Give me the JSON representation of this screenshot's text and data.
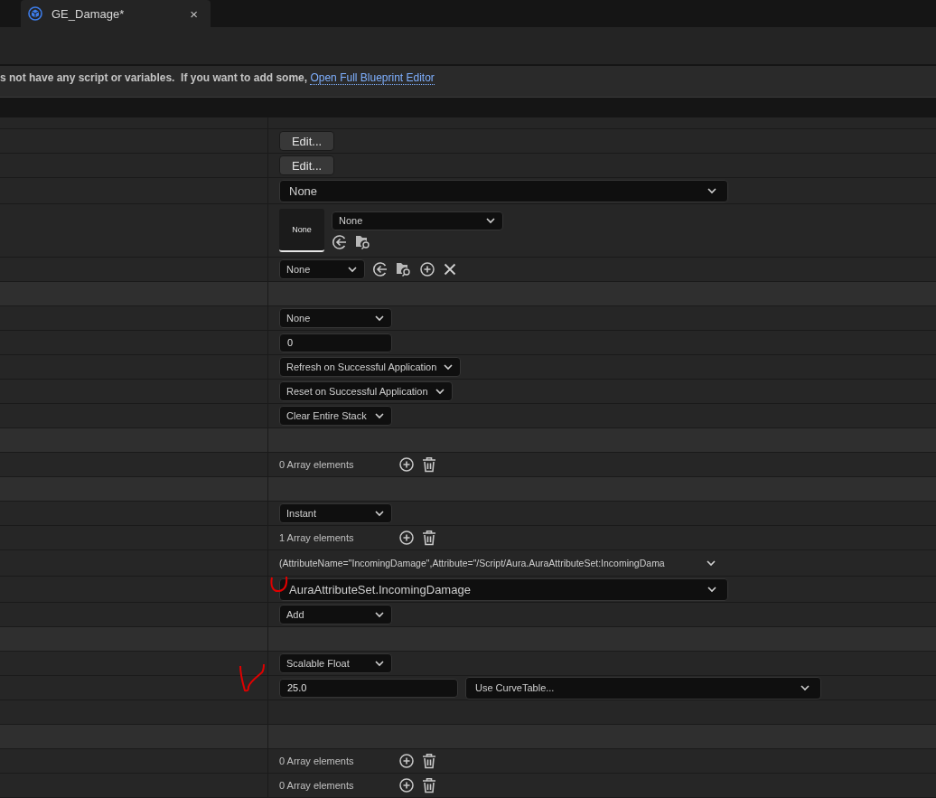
{
  "tab": {
    "title": "GE_Damage*",
    "close": "×",
    "selected": true
  },
  "info_bar": {
    "text": "s not have any script or variables.  If you want to add some, ",
    "link": "Open Full Blueprint Editor"
  },
  "rows": [
    {
      "kind": "partial"
    },
    {
      "kind": "button",
      "label": "Edit..."
    },
    {
      "kind": "button",
      "label": "Edit..."
    },
    {
      "kind": "combo",
      "value": "None",
      "wide": true
    },
    {
      "kind": "asset",
      "thumbnail": "None",
      "value": "None"
    },
    {
      "kind": "picker",
      "value": "None"
    },
    {
      "kind": "category"
    },
    {
      "kind": "combo",
      "value": "None",
      "wide": false
    },
    {
      "kind": "field",
      "value": "0"
    },
    {
      "kind": "combo",
      "value": "Refresh on Successful Application",
      "wide": false
    },
    {
      "kind": "combo",
      "value": "Reset on Successful Application",
      "wide": false
    },
    {
      "kind": "combo",
      "value": "Clear Entire Stack",
      "wide": false
    },
    {
      "kind": "category"
    },
    {
      "kind": "array",
      "count": "0 Array elements"
    },
    {
      "kind": "category"
    },
    {
      "kind": "combo",
      "value": "Instant",
      "wide": false
    },
    {
      "kind": "array",
      "count": "1 Array elements"
    },
    {
      "kind": "struct",
      "value": "(AttributeName=\"IncomingDamage\",Attribute=\"/Script/Aura.AuraAttributeSet:IncomingDama"
    },
    {
      "kind": "combo",
      "value": "AuraAttributeSet.IncomingDamage",
      "wide": true
    },
    {
      "kind": "combo",
      "value": "Add",
      "wide": false
    },
    {
      "kind": "category"
    },
    {
      "kind": "combo",
      "value": "Scalable Float",
      "wide": false
    },
    {
      "kind": "float",
      "value": "25.0",
      "curve": "Use CurveTable..."
    },
    {
      "kind": "empty"
    },
    {
      "kind": "category"
    },
    {
      "kind": "array",
      "count": "0 Array elements"
    },
    {
      "kind": "array",
      "count": "0 Array elements"
    }
  ]
}
